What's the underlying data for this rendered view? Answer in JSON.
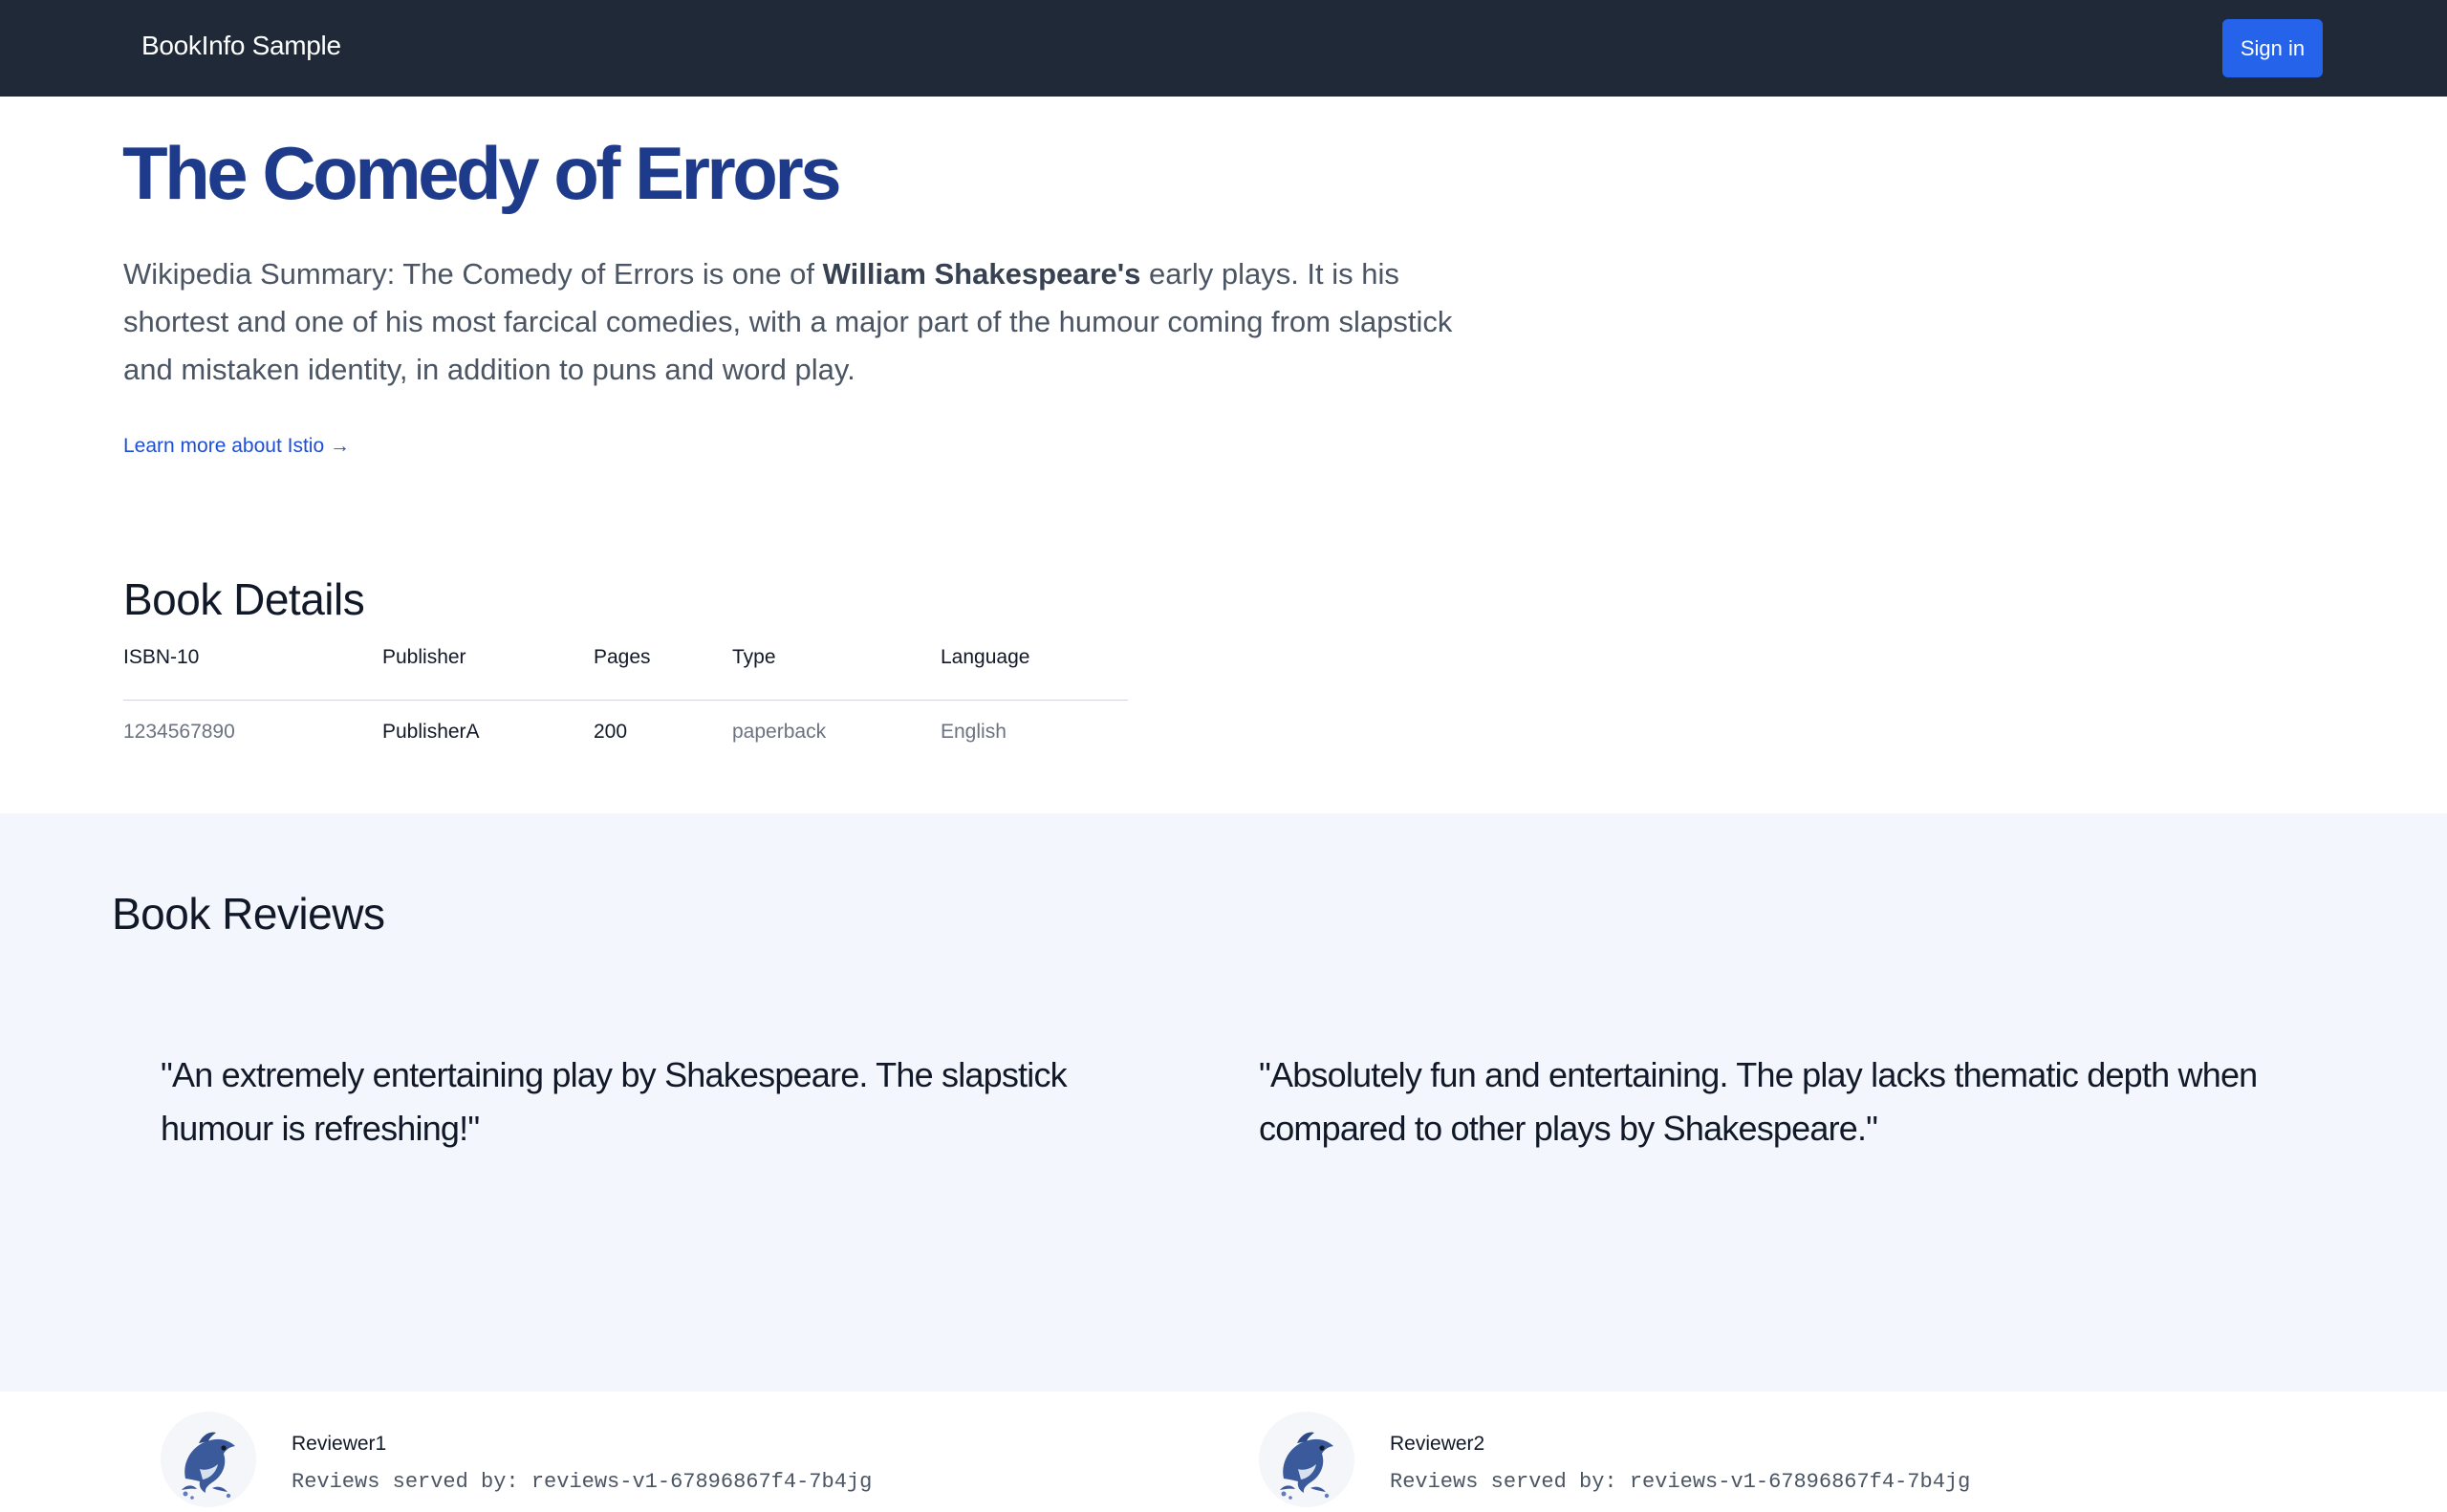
{
  "navbar": {
    "brand": "BookInfo Sample",
    "signin_label": "Sign in"
  },
  "book": {
    "title": "The Comedy of Errors",
    "summary_prefix": "Wikipedia Summary: The Comedy of Errors is one of ",
    "summary_bold": "William Shakespeare's",
    "summary_suffix": " early plays. It is his shortest and one of his most farcical comedies, with a major part of the humour coming from slapstick and mistaken identity, in addition to puns and word play.",
    "learn_more": "Learn more about Istio →"
  },
  "details": {
    "heading": "Book Details",
    "columns": [
      "ISBN-10",
      "Publisher",
      "Pages",
      "Type",
      "Language"
    ],
    "row": [
      "1234567890",
      "PublisherA",
      "200",
      "paperback",
      "English"
    ]
  },
  "reviews": {
    "heading": "Book Reviews",
    "items": [
      {
        "text": "\"An extremely entertaining play by Shakespeare. The slapstick humour is refreshing!\"",
        "reviewer": "Reviewer1",
        "served_by": "Reviews served by: reviews-v1-67896867f4-7b4jg",
        "avatar_icon": "dolphin-icon"
      },
      {
        "text": "\"Absolutely fun and entertaining. The play lacks thematic depth when compared to other plays by Shakespeare.\"",
        "reviewer": "Reviewer2",
        "served_by": "Reviews served by: reviews-v1-67896867f4-7b4jg",
        "avatar_icon": "dolphin-icon"
      }
    ]
  },
  "colors": {
    "navbar": "#1f2937",
    "signin": "#2563eb",
    "title": "#1e3a8a",
    "link": "#1d4ed8",
    "reviews_bg": "#f3f6fc"
  }
}
